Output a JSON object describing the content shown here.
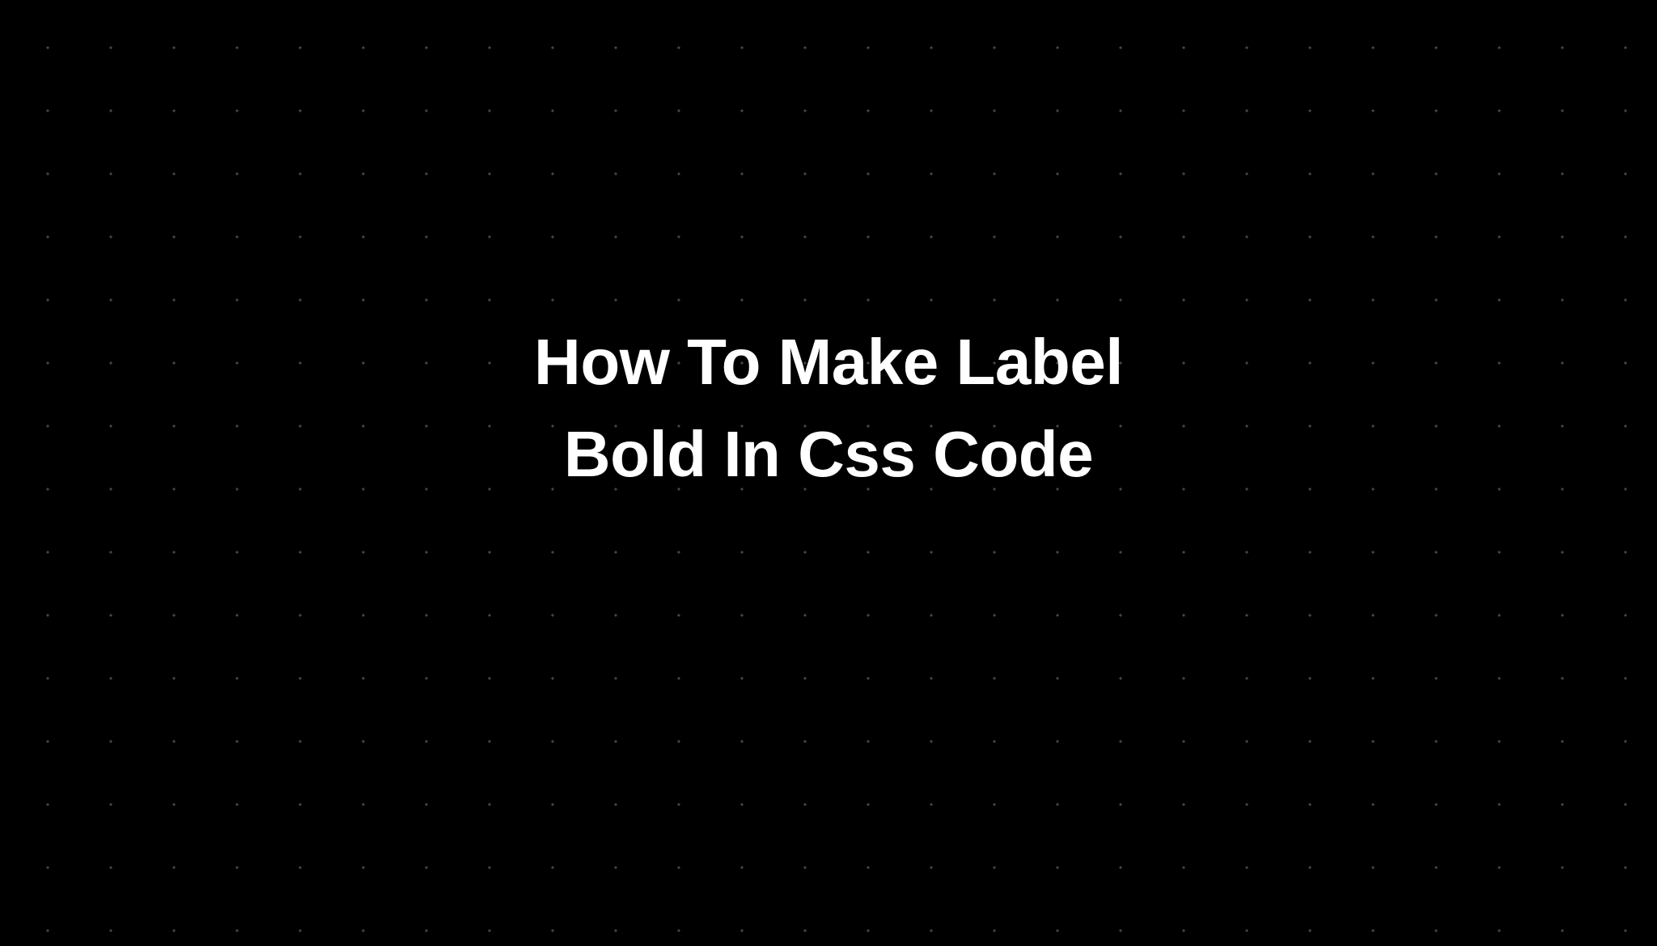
{
  "title": {
    "line1": "How To Make Label",
    "line2": "Bold In Css Code"
  },
  "colors": {
    "background": "#000000",
    "text": "#ffffff",
    "dots": "rgba(255, 255, 255, 0.28)"
  }
}
